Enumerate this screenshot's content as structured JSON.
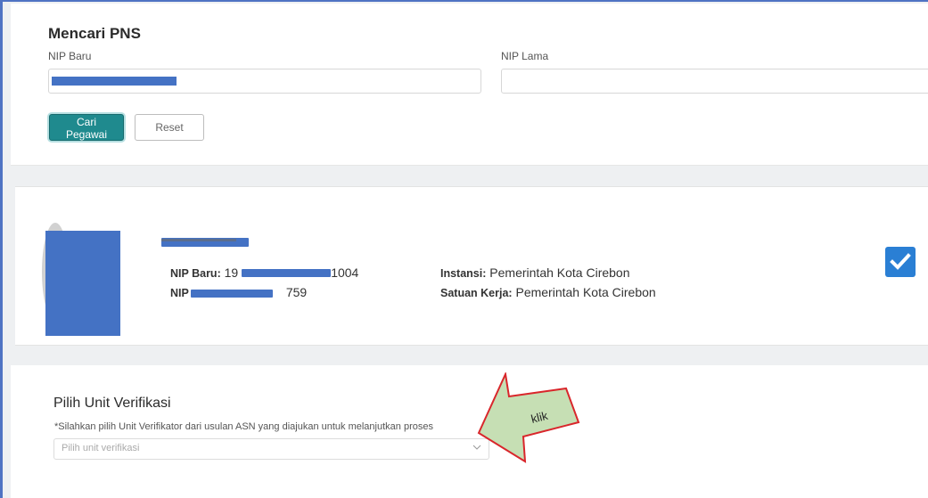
{
  "search": {
    "title": "Mencari PNS",
    "nip_baru_label": "NIP Baru",
    "nip_lama_label": "NIP Lama",
    "search_button": "Cari Pegawai",
    "reset_button": "Reset"
  },
  "employee": {
    "nip_baru_label": "NIP Baru:",
    "nip_baru_prefix": "19",
    "nip_baru_suffix": "1004",
    "nip_label_prefix": "NIP",
    "nip_suffix": "759",
    "instansi_label": "Instansi:",
    "instansi_value": "Pemerintah Kota Cirebon",
    "satuan_label": "Satuan Kerja:",
    "satuan_value": "Pemerintah Kota Cirebon"
  },
  "unit": {
    "title": "Pilih Unit Verifikasi",
    "hint": "*Silahkan pilih Unit Verifikator dari usulan ASN yang diajukan untuk melanjutkan proses",
    "placeholder": "Pilih unit verifikasi"
  },
  "annotation": {
    "text": "klik",
    "fill": "#c6dfb4",
    "stroke": "#d9262b"
  },
  "colors": {
    "primary": "#1f8a8e",
    "check": "#2a7fd4",
    "redaction": "#4472c4"
  },
  "icons": {
    "check": "check-icon",
    "dropdown": "chevron-down-icon"
  }
}
